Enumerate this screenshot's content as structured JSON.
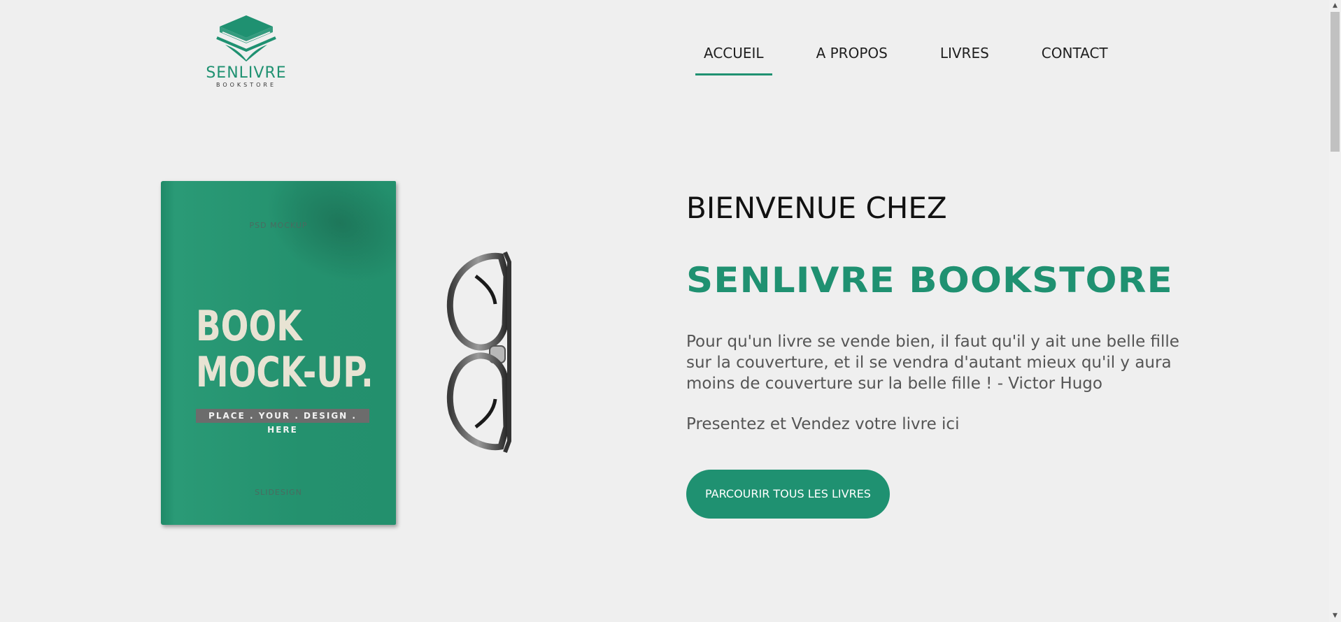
{
  "logo": {
    "name": "SENLIVRE",
    "sub": "BOOKSTORE"
  },
  "nav": {
    "items": [
      {
        "label": "ACCUEIL",
        "active": true
      },
      {
        "label": "A PROPOS",
        "active": false
      },
      {
        "label": "LIVRES",
        "active": false
      },
      {
        "label": "CONTACT",
        "active": false
      }
    ]
  },
  "hero_image": {
    "book_title_line1": "BOOK",
    "book_title_line2": "MOCK-UP.",
    "book_strip": "PLACE . YOUR . DESIGN . HERE",
    "book_top_text": "PSD MOCKUP",
    "book_bottom_text": "SLIDESIGN"
  },
  "hero": {
    "welcome": "BIENVENUE CHEZ",
    "brand": "SENLIVRE BOOKSTORE",
    "quote": "Pour qu'un livre se vende bien, il faut qu'il y ait une belle fille sur la couverture, et il se vendra d'autant mieux qu'il y aura moins de couverture sur la belle fille ! - Victor Hugo",
    "tagline": "Presentez et Vendez votre livre ici",
    "cta_label": "PARCOURIR TOUS LES LIVRES"
  },
  "colors": {
    "accent": "#1f9171",
    "background": "#efefef"
  }
}
